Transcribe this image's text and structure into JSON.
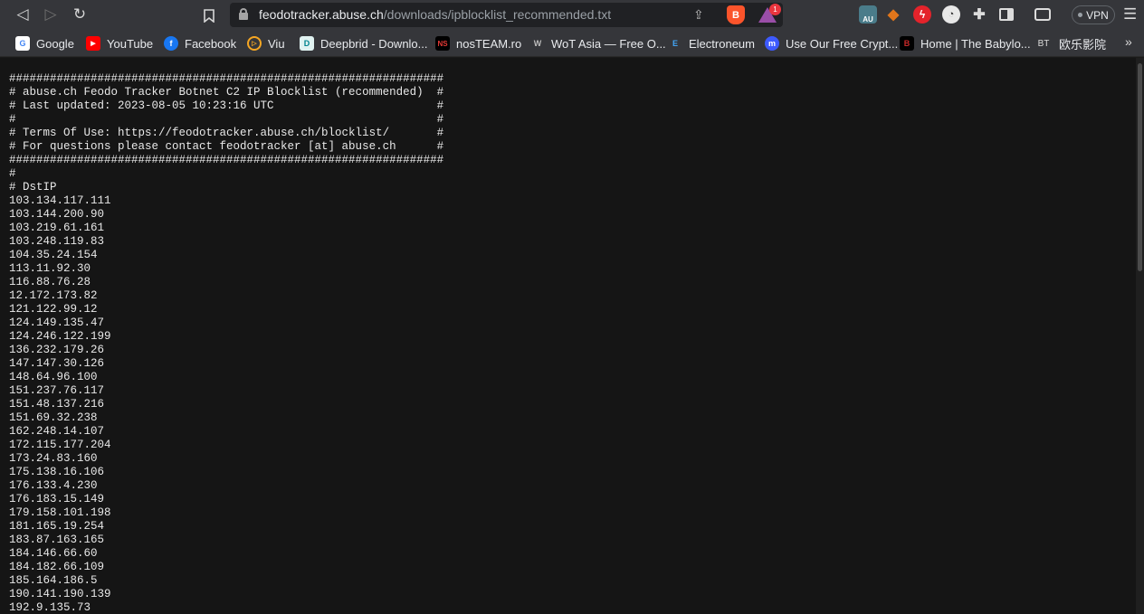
{
  "browser": {
    "url_host": "feodotracker.abuse.ch",
    "url_path": "/downloads/ipblocklist_recommended.txt",
    "rewards_badge": "1",
    "vpn_label": "VPN",
    "ext_au_label": "AU",
    "brave_label": "B"
  },
  "bookmarks": [
    {
      "label": "Google",
      "icon": "google-icon",
      "color": "#ffffff"
    },
    {
      "label": "YouTube",
      "icon": "youtube-icon",
      "color": "#ff0000"
    },
    {
      "label": "Facebook",
      "icon": "facebook-icon",
      "color": "#1877f2"
    },
    {
      "label": "Viu",
      "icon": "viu-icon",
      "color": "#f5a623"
    },
    {
      "label": "Deepbrid - Downlo...",
      "icon": "deepbrid-icon",
      "color": "#4fc3f7"
    },
    {
      "label": "nosTEAM.ro",
      "icon": "nosteam-icon",
      "color": "#c62828"
    },
    {
      "label": "WoT Asia — Free O...",
      "icon": "wot-icon",
      "color": "#9e9e9e"
    },
    {
      "label": "Electroneum",
      "icon": "electroneum-icon",
      "color": "#2196f3"
    },
    {
      "label": "Use Our Free Crypt...",
      "icon": "crypto-icon",
      "color": "#3d5afe"
    },
    {
      "label": "Home | The Babylo...",
      "icon": "babylon-icon",
      "color": "#000000"
    },
    {
      "label": "欧乐影院",
      "icon": "bt-icon",
      "color": "#35363a"
    }
  ],
  "bookmark_icon_glyphs": {
    "google": "G",
    "youtube": "▶",
    "facebook": "f",
    "viu": "▷",
    "deepbrid": "D",
    "nosteam": "NS",
    "wot": "W",
    "electroneum": "E",
    "crypto": "m",
    "babylon": "B",
    "bt": "BT"
  },
  "document": {
    "lines": [
      "################################################################",
      "# abuse.ch Feodo Tracker Botnet C2 IP Blocklist (recommended)  #",
      "# Last updated: 2023-08-05 10:23:16 UTC                        #",
      "#                                                              #",
      "# Terms Of Use: https://feodotracker.abuse.ch/blocklist/       #",
      "# For questions please contact feodotracker [at] abuse.ch      #",
      "################################################################",
      "#",
      "# DstIP",
      "103.134.117.111",
      "103.144.200.90",
      "103.219.61.161",
      "103.248.119.83",
      "104.35.24.154",
      "113.11.92.30",
      "116.88.76.28",
      "12.172.173.82",
      "121.122.99.12",
      "124.149.135.47",
      "124.246.122.199",
      "136.232.179.26",
      "147.147.30.126",
      "148.64.96.100",
      "151.237.76.117",
      "151.48.137.216",
      "151.69.32.238",
      "162.248.14.107",
      "172.115.177.204",
      "173.24.83.160",
      "175.138.16.106",
      "176.133.4.230",
      "176.183.15.149",
      "179.158.101.198",
      "181.165.19.254",
      "183.87.163.165",
      "184.146.66.60",
      "184.182.66.109",
      "185.164.186.5",
      "190.141.190.139",
      "192.9.135.73"
    ]
  }
}
